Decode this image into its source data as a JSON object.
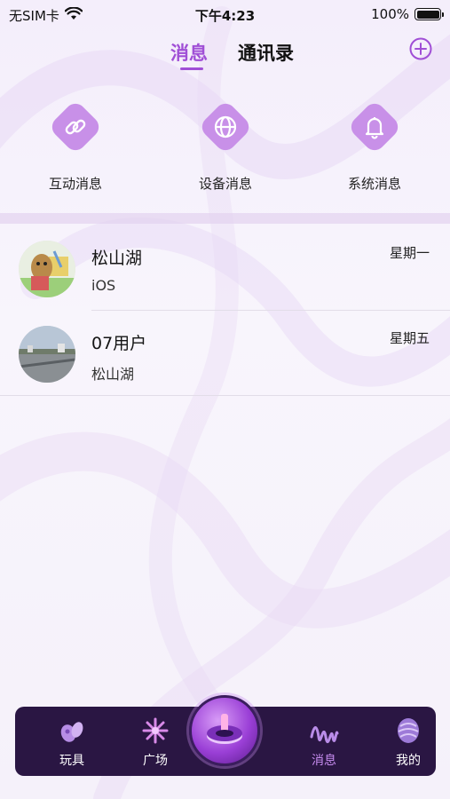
{
  "status_bar": {
    "carrier": "无SIM卡",
    "time": "下午4:23",
    "battery": "100%",
    "battery_level": 1.0
  },
  "header": {
    "tabs": [
      {
        "label": "消息",
        "active": true
      },
      {
        "label": "通讯录",
        "active": false
      }
    ],
    "add_icon": "plus-circle-icon"
  },
  "categories": [
    {
      "label": "互动消息",
      "icon": "link-icon"
    },
    {
      "label": "设备消息",
      "icon": "globe-icon"
    },
    {
      "label": "系统消息",
      "icon": "bell-icon"
    }
  ],
  "conversations": [
    {
      "name": "松山湖",
      "subtitle": "iOS",
      "time": "星期一",
      "avatar": "cartoon-character-avatar"
    },
    {
      "name": "07用户",
      "subtitle": "松山湖",
      "time": "星期五",
      "avatar": "landscape-photo-avatar"
    }
  ],
  "tab_bar": {
    "items": [
      {
        "label": "玩具",
        "icon": "toy-icon",
        "active": false
      },
      {
        "label": "广场",
        "icon": "sparkle-icon",
        "active": false
      },
      {
        "label": "消息",
        "icon": "message-wave-icon",
        "active": true
      },
      {
        "label": "我的",
        "icon": "profile-orb-icon",
        "active": false
      }
    ],
    "center_icon": "device-center-icon"
  },
  "colors": {
    "accent": "#a04fd6",
    "icon_bg": "#c890e8",
    "tabbar_bg": "#2a1643",
    "active_nav": "#c78cf0"
  }
}
